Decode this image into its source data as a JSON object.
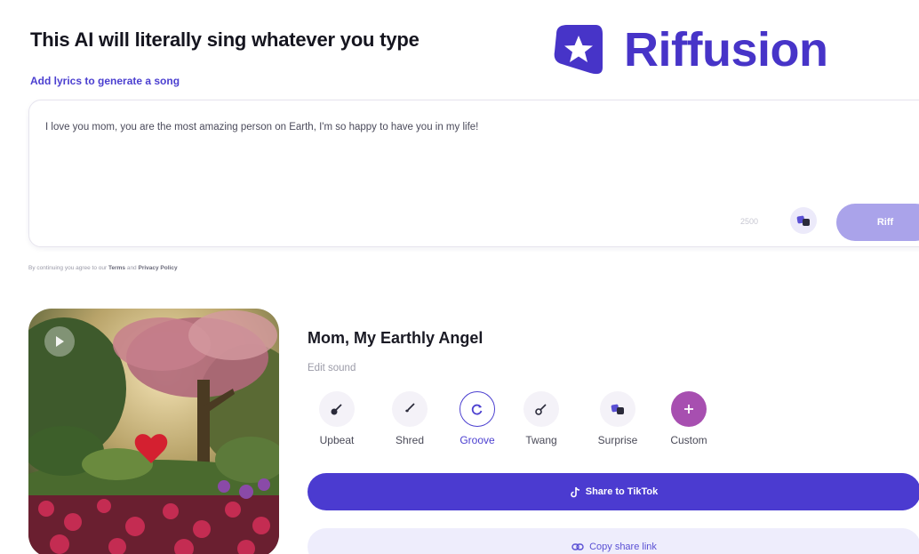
{
  "header": {
    "headline": "This AI will literally sing whatever you type",
    "sublink": "Add lyrics to generate a song"
  },
  "brand": {
    "name": "Riffusion",
    "color": "#4734c8",
    "icon": "riffusion-star-logo"
  },
  "composer": {
    "lyrics": "I love you mom, you are the most amazing person on Earth, I'm so happy to have you in my life!",
    "char_count": "2500",
    "dice_icon": "dice-icon",
    "riff_label": "Riff"
  },
  "terms": {
    "prefix": "By continuing you agree to our",
    "terms_label": "Terms",
    "and": "and",
    "privacy_label": "Privacy Policy"
  },
  "song": {
    "title": "Mom, My Earthly Angel",
    "edit_sound_label": "Edit sound",
    "sounds": [
      {
        "label": "Upbeat",
        "icon": "guitar-icon",
        "active": false
      },
      {
        "label": "Shred",
        "icon": "electric-guitar-icon",
        "active": false
      },
      {
        "label": "Groove",
        "icon": "refresh-icon",
        "active": true
      },
      {
        "label": "Twang",
        "icon": "banjo-icon",
        "active": false
      },
      {
        "label": "Surprise",
        "icon": "dice-icon",
        "active": false
      },
      {
        "label": "Custom",
        "icon": "plus-icon",
        "active": false
      }
    ],
    "tiktok_label": "Share to TikTok",
    "copy_label": "Copy share link"
  },
  "colors": {
    "accent": "#4b3bd0",
    "accent_light": "#eeedfc",
    "custom_purple": "#a74fb0"
  }
}
